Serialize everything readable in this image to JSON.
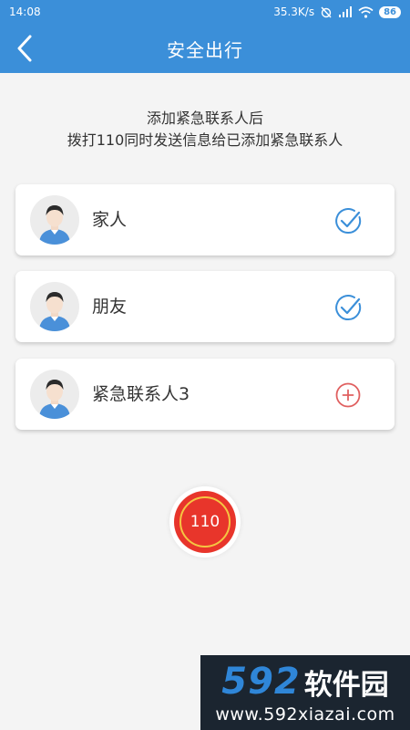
{
  "status_bar": {
    "time": "14:08",
    "speed": "35.3K/s",
    "battery": "86"
  },
  "header": {
    "title": "安全出行"
  },
  "notice": {
    "line1": "添加紧急联系人后",
    "line2": "拨打110同时发送信息给已添加紧急联系人"
  },
  "contacts": [
    {
      "label": "家人",
      "status": "added",
      "icon": "check-circle-icon"
    },
    {
      "label": "朋友",
      "status": "added",
      "icon": "check-circle-icon"
    },
    {
      "label": "紧急联系人3",
      "status": "empty",
      "icon": "plus-circle-icon"
    }
  ],
  "call_button": {
    "label": "110"
  },
  "watermark": {
    "number": "592",
    "brand": "软件园",
    "url": "www.592xiazai.com"
  },
  "colors": {
    "primary": "#3b8fd9",
    "check": "#3b8fd9",
    "add": "#e06060",
    "call": "#e8352b",
    "call_ring": "#f5c542"
  }
}
